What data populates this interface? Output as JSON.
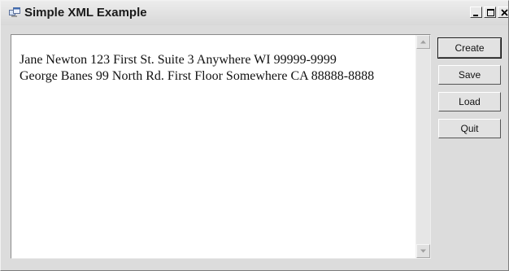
{
  "window": {
    "title": "Simple XML Example",
    "controls": {
      "minimize_icon": "minimize-icon",
      "maximize_icon": "maximize-icon",
      "close_icon": "close-icon"
    }
  },
  "content": {
    "lines": [
      "Jane Newton 123 First St. Suite 3 Anywhere WI 99999-9999",
      "George Banes 99 North Rd. First Floor Somewhere CA 88888-8888"
    ]
  },
  "buttons": {
    "create": "Create",
    "save": "Save",
    "load": "Load",
    "quit": "Quit"
  },
  "colors": {
    "window_bg": "#dcdcdc",
    "text_bg": "#ffffff"
  }
}
